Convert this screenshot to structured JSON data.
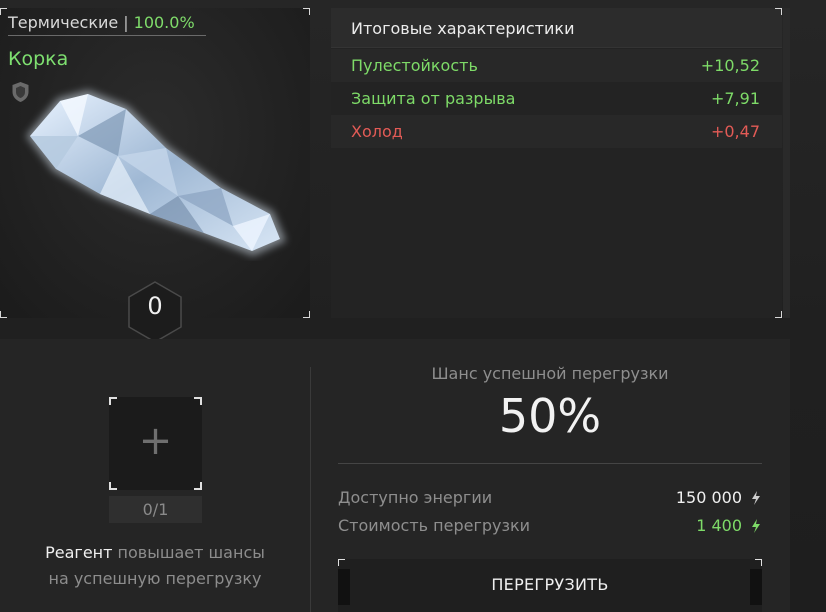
{
  "item": {
    "category": "Термические",
    "separator": "|",
    "percent": "100.0%",
    "name": "Корка",
    "level": "0",
    "icons": [
      "shield-icon",
      "artifact-image",
      "hexagon-badge"
    ]
  },
  "stats": {
    "title": "Итоговые характеристики",
    "rows": [
      {
        "label": "Пулестойкость",
        "value": "+10,52",
        "color": "#7edb68"
      },
      {
        "label": "Защита от разрыва",
        "value": "+7,91",
        "color": "#7edb68"
      },
      {
        "label": "Холод",
        "value": "+0,47",
        "color": "#e35b56"
      }
    ]
  },
  "reagent": {
    "slot_symbol": "+",
    "count": "0/1",
    "hint_strong": "Реагент",
    "hint_line1_rest": " повышает шансы",
    "hint_line2": "на успешную перегрузку"
  },
  "overload": {
    "chance_label": "Шанс успешной перегрузки",
    "chance_value": "50%",
    "energy_label": "Доступно энергии",
    "energy_value": "150 000",
    "cost_label": "Стоимость перегрузки",
    "cost_value": "1 400",
    "button_label": "ПЕРЕГРУЗИТЬ",
    "colors": {
      "energy_bolt": "#cfcfcf",
      "cost": "#7edb68"
    }
  }
}
